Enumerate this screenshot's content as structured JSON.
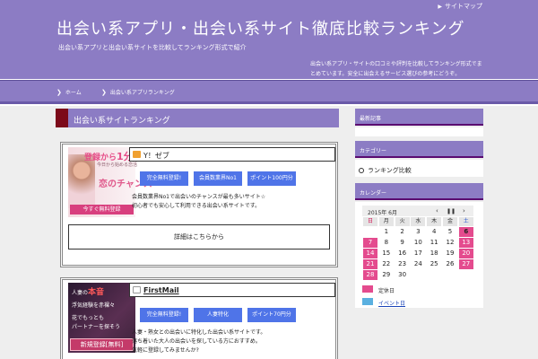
{
  "header": {
    "top_link": "サイトマップ",
    "site_title": "出会い系アプリ・出会い系サイト徹底比較ランキング",
    "site_desc": "出会い系アプリと出会い系サイトを比較してランキング形式で紹介",
    "note": "出会い系アプリ・サイトの口コミや評判を比較してランキング形式でまとめています。安全に出会えるサービス選びの参考にどうぞ。"
  },
  "nav": {
    "items": [
      "ホーム",
      "出会い系アプリランキング"
    ]
  },
  "main": {
    "section_title": "出会い系サイトランキング",
    "cards": [
      {
        "name": "Y！ゼブ",
        "banner_top": "登録から",
        "banner_top_accent": "1分",
        "banner_mid": "恋のチャンス",
        "banner_sub": "今日から始める恋活",
        "banner_cta": "今すぐ無料登録",
        "badges": [
          "完全無料登録!",
          "会員数業界No1",
          "ポイント100円分"
        ],
        "lines": [
          "会員数業界No1で出会いのチャンスが最も多いサイト☆",
          "初心者でも安心して利用できる出会い系サイトです。"
        ],
        "detail_label": "詳細はこちらから"
      },
      {
        "name": "FirstMail",
        "banner_lines": [
          "人妻の",
          "本音",
          "浮気経験を赤裸々",
          "花でもっとも",
          "パートナーを探そう"
        ],
        "banner_cta": "新規登録[無料]",
        "badges": [
          "完全無料登録!",
          "人妻特化",
          "ポイント70円分"
        ],
        "lines": [
          "人妻・熟女との出会いに特化した出会い系サイトです。",
          "落ち着いた大人の出会いを探している方におすすめ。",
          "気軽に登録してみませんか?"
        ]
      }
    ]
  },
  "sidebar": {
    "widget1_title": "最新記事",
    "widget2_title": "カテゴリー",
    "category": "ランキング比較",
    "widget3_title": "カレンダー",
    "calendar": {
      "month_label": "2015年 6月",
      "controls": [
        "‹",
        "❚❚",
        "›"
      ],
      "dow": [
        "日",
        "月",
        "火",
        "水",
        "木",
        "金",
        "土"
      ],
      "weeks": [
        [
          "",
          "1",
          "2",
          "3",
          "4",
          "5",
          "6"
        ],
        [
          "7",
          "8",
          "9",
          "10",
          "11",
          "12",
          "13"
        ],
        [
          "14",
          "15",
          "16",
          "17",
          "18",
          "19",
          "20"
        ],
        [
          "21",
          "22",
          "23",
          "24",
          "25",
          "26",
          "27"
        ],
        [
          "28",
          "29",
          "30",
          "",
          "",
          "",
          ""
        ]
      ]
    },
    "legend": [
      {
        "label": "定休日",
        "color": "#e44b8e"
      },
      {
        "label": "イベント日",
        "color": "#5ab0e0"
      }
    ]
  },
  "colors": {
    "header_bg": "#8c7cc4",
    "accent_maroon": "#7c0a1a",
    "badge_blue": "#4f74e8",
    "calendar_pink": "#e44b8e"
  }
}
